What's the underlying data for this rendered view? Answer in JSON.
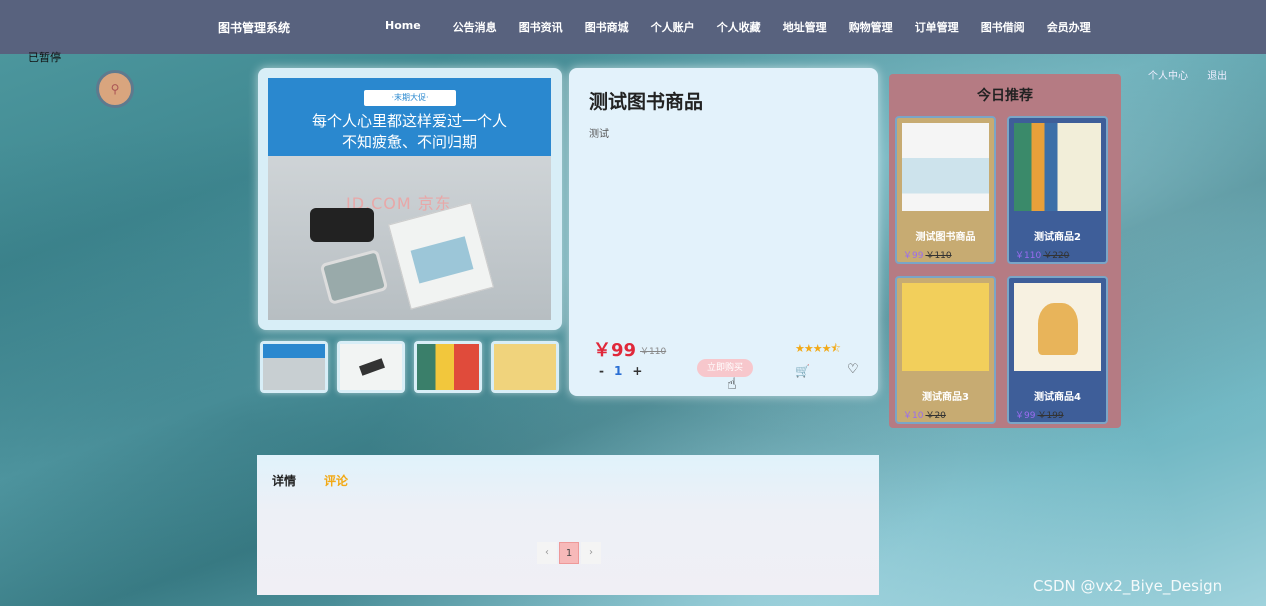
{
  "header": {
    "brand": "图书管理系统",
    "nav": [
      "Home",
      "公告消息",
      "图书资讯",
      "图书商城",
      "个人账户",
      "个人收藏",
      "地址管理",
      "购物管理",
      "订单管理",
      "图书借阅",
      "会员办理"
    ],
    "user_links": [
      "个人中心",
      "退出"
    ]
  },
  "overlay": {
    "paused_label": "已暂停",
    "search_icon": "search-icon"
  },
  "gallery": {
    "banner_tag": "·末期大促·",
    "banner_line1": "每个人心里都这样爱过一个人",
    "banner_line2": "不知疲惫、不问归期",
    "photo_brand": "JD.COM 京东",
    "thumb_count_label": "4"
  },
  "product": {
    "title": "测试图书商品",
    "description": "测试",
    "price": "￥99",
    "old_price": "￥110",
    "rating": 4.5,
    "stars": "★★★★⯪",
    "quantity": "1",
    "minus": "-",
    "plus": "+",
    "buy_label": "立即购买",
    "cart_icon": "cart-icon",
    "favorite_icon": "heart-icon"
  },
  "recommend": {
    "title": "今日推荐",
    "items": [
      {
        "name": "测试图书商品",
        "price": "￥99",
        "old_price": "￥110"
      },
      {
        "name": "测试商品2",
        "price": "￥110",
        "old_price": "￥220"
      },
      {
        "name": "测试商品3",
        "price": "￥10",
        "old_price": "￥20"
      },
      {
        "name": "测试商品4",
        "price": "￥99",
        "old_price": "￥199"
      }
    ]
  },
  "tabs": {
    "detail": "详情",
    "comment": "评论"
  },
  "pager": {
    "prev": "‹",
    "current": "1",
    "next": "›"
  },
  "watermark": "CSDN @vx2_Biye_Design",
  "colors": {
    "topbar": "#58627e",
    "price": "#e0283a",
    "accent": "#f2a916",
    "rec_panel": "#b57b83"
  }
}
